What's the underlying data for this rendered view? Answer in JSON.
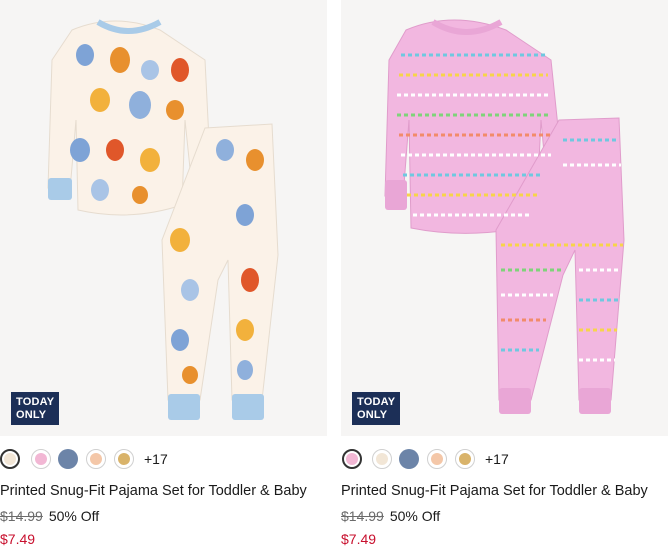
{
  "colors": {
    "badge_bg": "#1c2f57",
    "sale_price": "#c8102e",
    "strike_price": "#6b6b6b"
  },
  "products": [
    {
      "badge_line1": "TODAY",
      "badge_line2": "ONLY",
      "name": "Printed Snug-Fit Pajama Set for Toddler & Baby",
      "was_price": "$14.99",
      "discount": "50% Off",
      "sale_price": "$7.49",
      "more_colors": "+17",
      "image": "monster-print-pajama-set-cream-blue",
      "swatches": [
        {
          "color": "#f2e6d6",
          "icon": "monster-print-swatch",
          "selected": true
        },
        {
          "color": "#f2b7d4",
          "icon": "pink-print-swatch",
          "selected": false
        },
        {
          "color": "#6c84a8",
          "icon": "navy-swatch",
          "selected": false
        },
        {
          "color": "#f4c7a8",
          "icon": "peach-print-swatch",
          "selected": false
        },
        {
          "color": "#d9b36a",
          "icon": "tan-print-swatch",
          "selected": false
        }
      ]
    },
    {
      "badge_line1": "TODAY",
      "badge_line2": "ONLY",
      "name": "Printed Snug-Fit Pajama Set for Toddler & Baby",
      "was_price": "$14.99",
      "discount": "50% Off",
      "sale_price": "$7.49",
      "more_colors": "+17",
      "image": "friendship-bead-print-pajama-set-pink",
      "swatches": [
        {
          "color": "#f2b7d4",
          "icon": "pink-print-swatch",
          "selected": true
        },
        {
          "color": "#f2e6d6",
          "icon": "monster-print-swatch",
          "selected": false
        },
        {
          "color": "#6c84a8",
          "icon": "navy-swatch",
          "selected": false
        },
        {
          "color": "#f4c7a8",
          "icon": "peach-print-swatch",
          "selected": false
        },
        {
          "color": "#d9b36a",
          "icon": "tan-print-swatch",
          "selected": false
        }
      ]
    }
  ]
}
